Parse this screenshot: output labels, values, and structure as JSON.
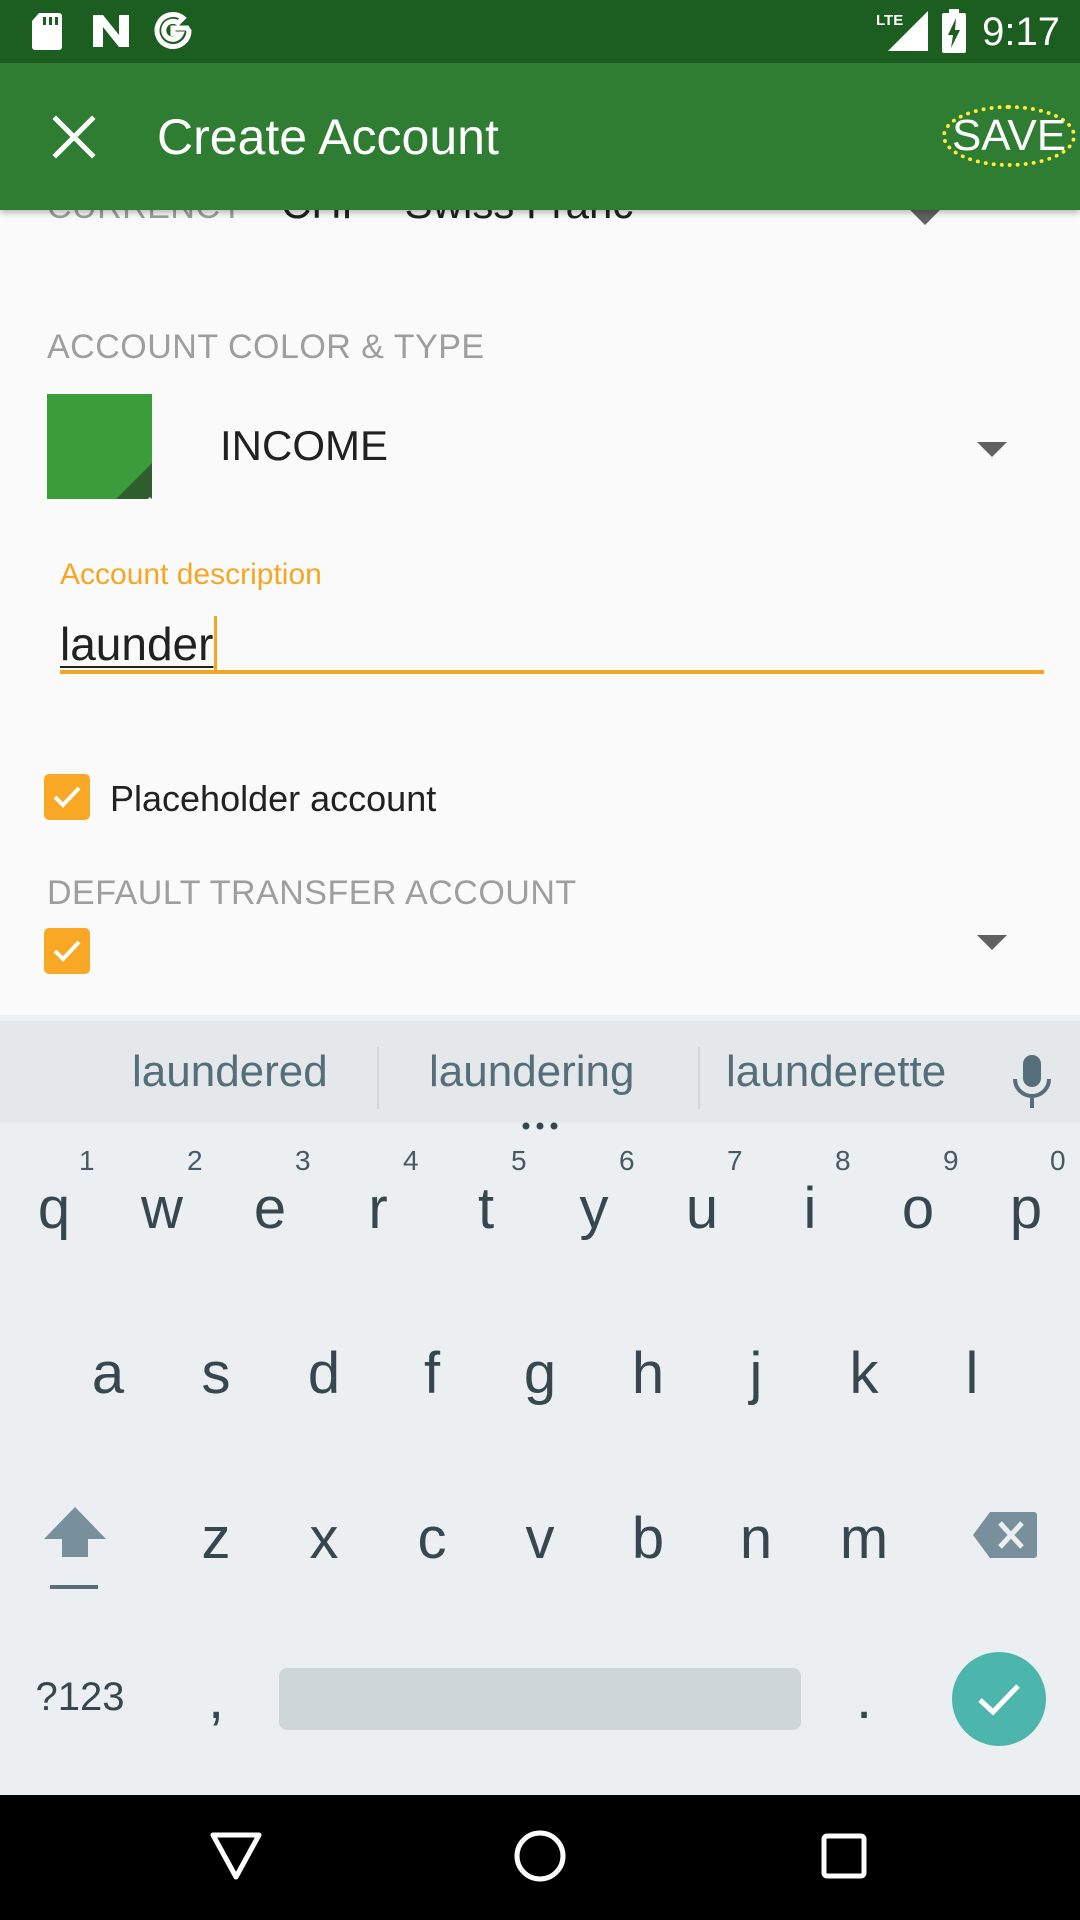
{
  "status_bar": {
    "time": "9:17",
    "left_icons": [
      "sd-card-icon",
      "n-icon",
      "google-icon"
    ],
    "right_icons": [
      "lte-signal-icon",
      "battery-charging-icon"
    ],
    "network_label": "LTE"
  },
  "toolbar": {
    "title": "Create Account",
    "save_label": "SAVE",
    "close_icon": "close-icon",
    "color": "#2e7d32"
  },
  "form": {
    "currency_label": "CURRENCY",
    "currency_value": "CHF - Swiss Franc",
    "color_type_label": "ACCOUNT COLOR & TYPE",
    "account_color": "#3a9d3a",
    "account_type": "INCOME",
    "description_label": "Account description",
    "description_value": "launder",
    "placeholder_label": "Placeholder account",
    "placeholder_checked": true,
    "default_transfer_label": "DEFAULT TRANSFER ACCOUNT",
    "default_transfer_checked": true,
    "accent_color": "#f5a623"
  },
  "keyboard": {
    "suggestions": [
      "laundered",
      "laundering",
      "launderette"
    ],
    "row1": [
      "q",
      "w",
      "e",
      "r",
      "t",
      "y",
      "u",
      "i",
      "o",
      "p"
    ],
    "row1_hints": [
      "1",
      "2",
      "3",
      "4",
      "5",
      "6",
      "7",
      "8",
      "9",
      "0"
    ],
    "row2": [
      "a",
      "s",
      "d",
      "f",
      "g",
      "h",
      "j",
      "k",
      "l"
    ],
    "row3": [
      "z",
      "x",
      "c",
      "v",
      "b",
      "n",
      "m"
    ],
    "symbols_label": "?123",
    "comma": ",",
    "period": "."
  },
  "nav_bar": {
    "icons": [
      "back-icon",
      "home-icon",
      "recents-icon"
    ]
  }
}
